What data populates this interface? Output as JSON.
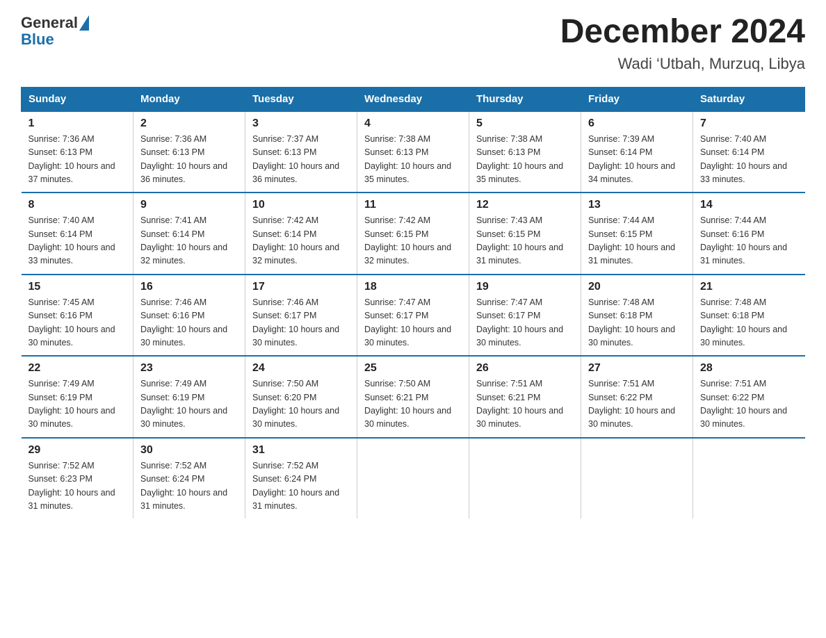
{
  "header": {
    "logo_general": "General",
    "logo_blue": "Blue",
    "month_title": "December 2024",
    "location": "Wadi ‘Utbah, Murzuq, Libya"
  },
  "days_of_week": [
    "Sunday",
    "Monday",
    "Tuesday",
    "Wednesday",
    "Thursday",
    "Friday",
    "Saturday"
  ],
  "weeks": [
    [
      {
        "day": "1",
        "sunrise": "7:36 AM",
        "sunset": "6:13 PM",
        "daylight": "10 hours and 37 minutes."
      },
      {
        "day": "2",
        "sunrise": "7:36 AM",
        "sunset": "6:13 PM",
        "daylight": "10 hours and 36 minutes."
      },
      {
        "day": "3",
        "sunrise": "7:37 AM",
        "sunset": "6:13 PM",
        "daylight": "10 hours and 36 minutes."
      },
      {
        "day": "4",
        "sunrise": "7:38 AM",
        "sunset": "6:13 PM",
        "daylight": "10 hours and 35 minutes."
      },
      {
        "day": "5",
        "sunrise": "7:38 AM",
        "sunset": "6:13 PM",
        "daylight": "10 hours and 35 minutes."
      },
      {
        "day": "6",
        "sunrise": "7:39 AM",
        "sunset": "6:14 PM",
        "daylight": "10 hours and 34 minutes."
      },
      {
        "day": "7",
        "sunrise": "7:40 AM",
        "sunset": "6:14 PM",
        "daylight": "10 hours and 33 minutes."
      }
    ],
    [
      {
        "day": "8",
        "sunrise": "7:40 AM",
        "sunset": "6:14 PM",
        "daylight": "10 hours and 33 minutes."
      },
      {
        "day": "9",
        "sunrise": "7:41 AM",
        "sunset": "6:14 PM",
        "daylight": "10 hours and 32 minutes."
      },
      {
        "day": "10",
        "sunrise": "7:42 AM",
        "sunset": "6:14 PM",
        "daylight": "10 hours and 32 minutes."
      },
      {
        "day": "11",
        "sunrise": "7:42 AM",
        "sunset": "6:15 PM",
        "daylight": "10 hours and 32 minutes."
      },
      {
        "day": "12",
        "sunrise": "7:43 AM",
        "sunset": "6:15 PM",
        "daylight": "10 hours and 31 minutes."
      },
      {
        "day": "13",
        "sunrise": "7:44 AM",
        "sunset": "6:15 PM",
        "daylight": "10 hours and 31 minutes."
      },
      {
        "day": "14",
        "sunrise": "7:44 AM",
        "sunset": "6:16 PM",
        "daylight": "10 hours and 31 minutes."
      }
    ],
    [
      {
        "day": "15",
        "sunrise": "7:45 AM",
        "sunset": "6:16 PM",
        "daylight": "10 hours and 30 minutes."
      },
      {
        "day": "16",
        "sunrise": "7:46 AM",
        "sunset": "6:16 PM",
        "daylight": "10 hours and 30 minutes."
      },
      {
        "day": "17",
        "sunrise": "7:46 AM",
        "sunset": "6:17 PM",
        "daylight": "10 hours and 30 minutes."
      },
      {
        "day": "18",
        "sunrise": "7:47 AM",
        "sunset": "6:17 PM",
        "daylight": "10 hours and 30 minutes."
      },
      {
        "day": "19",
        "sunrise": "7:47 AM",
        "sunset": "6:17 PM",
        "daylight": "10 hours and 30 minutes."
      },
      {
        "day": "20",
        "sunrise": "7:48 AM",
        "sunset": "6:18 PM",
        "daylight": "10 hours and 30 minutes."
      },
      {
        "day": "21",
        "sunrise": "7:48 AM",
        "sunset": "6:18 PM",
        "daylight": "10 hours and 30 minutes."
      }
    ],
    [
      {
        "day": "22",
        "sunrise": "7:49 AM",
        "sunset": "6:19 PM",
        "daylight": "10 hours and 30 minutes."
      },
      {
        "day": "23",
        "sunrise": "7:49 AM",
        "sunset": "6:19 PM",
        "daylight": "10 hours and 30 minutes."
      },
      {
        "day": "24",
        "sunrise": "7:50 AM",
        "sunset": "6:20 PM",
        "daylight": "10 hours and 30 minutes."
      },
      {
        "day": "25",
        "sunrise": "7:50 AM",
        "sunset": "6:21 PM",
        "daylight": "10 hours and 30 minutes."
      },
      {
        "day": "26",
        "sunrise": "7:51 AM",
        "sunset": "6:21 PM",
        "daylight": "10 hours and 30 minutes."
      },
      {
        "day": "27",
        "sunrise": "7:51 AM",
        "sunset": "6:22 PM",
        "daylight": "10 hours and 30 minutes."
      },
      {
        "day": "28",
        "sunrise": "7:51 AM",
        "sunset": "6:22 PM",
        "daylight": "10 hours and 30 minutes."
      }
    ],
    [
      {
        "day": "29",
        "sunrise": "7:52 AM",
        "sunset": "6:23 PM",
        "daylight": "10 hours and 31 minutes."
      },
      {
        "day": "30",
        "sunrise": "7:52 AM",
        "sunset": "6:24 PM",
        "daylight": "10 hours and 31 minutes."
      },
      {
        "day": "31",
        "sunrise": "7:52 AM",
        "sunset": "6:24 PM",
        "daylight": "10 hours and 31 minutes."
      },
      null,
      null,
      null,
      null
    ]
  ]
}
